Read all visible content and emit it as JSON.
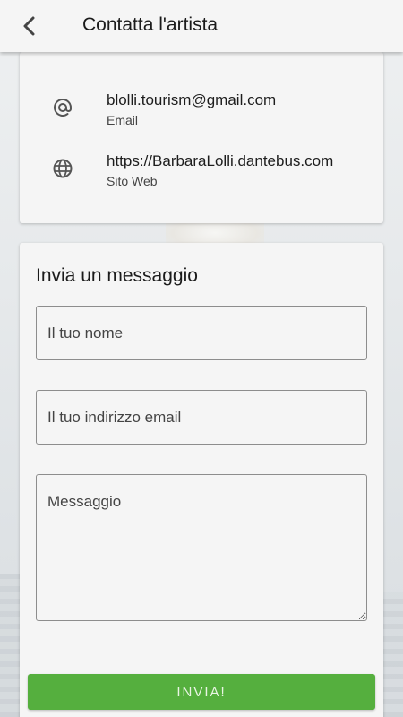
{
  "header": {
    "title": "Contatta l'artista",
    "back_icon": "chevron-left-icon"
  },
  "contact": {
    "items": [
      {
        "icon": "at-icon",
        "value": "blolli.tourism@gmail.com",
        "label": "Email"
      },
      {
        "icon": "globe-icon",
        "value": "https://BarbaraLolli.dantebus.com",
        "label": "Sito Web"
      }
    ]
  },
  "form": {
    "title": "Invia un messaggio",
    "name_placeholder": "Il tuo nome",
    "email_placeholder": "Il tuo indirizzo email",
    "message_placeholder": "Messaggio",
    "send_label": "INVIA!"
  },
  "colors": {
    "accent": "#55af3e",
    "card_bg": "#f5f5f5",
    "text": "#1b1b1b"
  }
}
